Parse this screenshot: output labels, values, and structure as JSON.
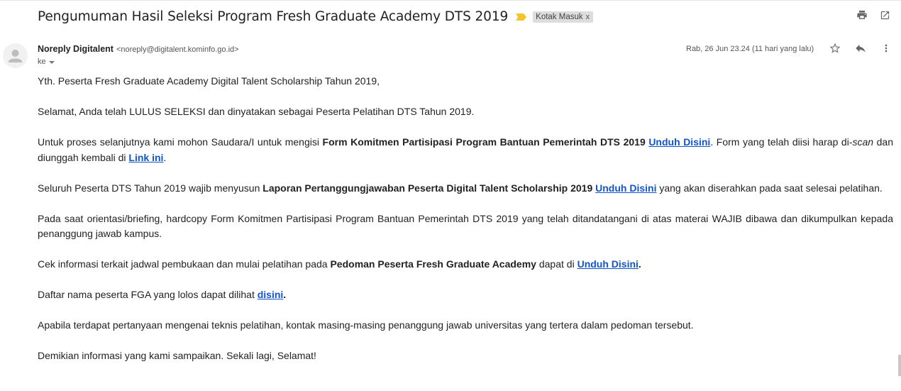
{
  "email": {
    "subject": "Pengumuman Hasil Seleksi Program Fresh Graduate Academy DTS 2019",
    "label": "Kotak Masuk",
    "label_remove": "x",
    "sender_name": "Noreply Digitalent",
    "sender_email": "<noreply@digitalent.kominfo.go.id>",
    "to_label": "ke",
    "date": "Rab, 26 Jun 23.24 (11 hari yang lalu)",
    "colors": {
      "link": "#1155cc",
      "important_marker": "#f4c430",
      "label_bg": "#dddddd"
    },
    "icons": [
      "print-icon",
      "new-window-icon",
      "star-icon",
      "reply-icon",
      "more-vert-icon",
      "avatar-icon",
      "important-marker-icon"
    ]
  },
  "body": {
    "p1": "Yth. Peserta Fresh Graduate Academy Digital Talent Scholarship Tahun 2019,",
    "p2": "Selamat, Anda telah LULUS SELEKSI dan dinyatakan sebagai Peserta Pelatihan DTS Tahun 2019.",
    "p3_a": "Untuk proses selanjutnya kami mohon Saudara/I untuk mengisi ",
    "p3_bold": "Form Komitmen Partisipasi Program Bantuan Pemerintah DTS 2019",
    "p3_link1": "Unduh Disini",
    "p3_b": ". Form yang telah diisi harap di-",
    "p3_italic": "scan",
    "p3_c": " dan diunggah kembali di ",
    "p3_link2": "Link ini",
    "p3_d": ".",
    "p4_a": "Seluruh Peserta DTS Tahun 2019 wajib menyusun ",
    "p4_bold": "Laporan Pertanggungjawaban Peserta Digital Talent Scholarship 2019",
    "p4_link": "Unduh Disini",
    "p4_b": " yang akan diserahkan pada saat selesai pelatihan.",
    "p5": "Pada saat orientasi/briefing, hardcopy Form Komitmen Partisipasi Program Bantuan Pemerintah DTS 2019 yang telah ditandatangani di atas materai WAJIB dibawa dan dikumpulkan kepada penanggung jawab kampus.",
    "p6_a": "Cek informasi terkait jadwal pembukaan dan mulai pelatihan pada ",
    "p6_bold": "Pedoman Peserta Fresh Graduate Academy",
    "p6_b": " dapat di ",
    "p6_link": "Unduh Disini",
    "p6_c": ".",
    "p7_a": "Daftar nama peserta FGA yang lolos dapat dilihat ",
    "p7_link": "disini",
    "p7_b": ".",
    "p8": "Apabila terdapat pertanyaan mengenai teknis pelatihan, kontak masing-masing penanggung jawab universitas yang tertera dalam pedoman tersebut.",
    "p9": "Demikian informasi yang kami sampaikan. Sekali lagi, Selamat!"
  }
}
